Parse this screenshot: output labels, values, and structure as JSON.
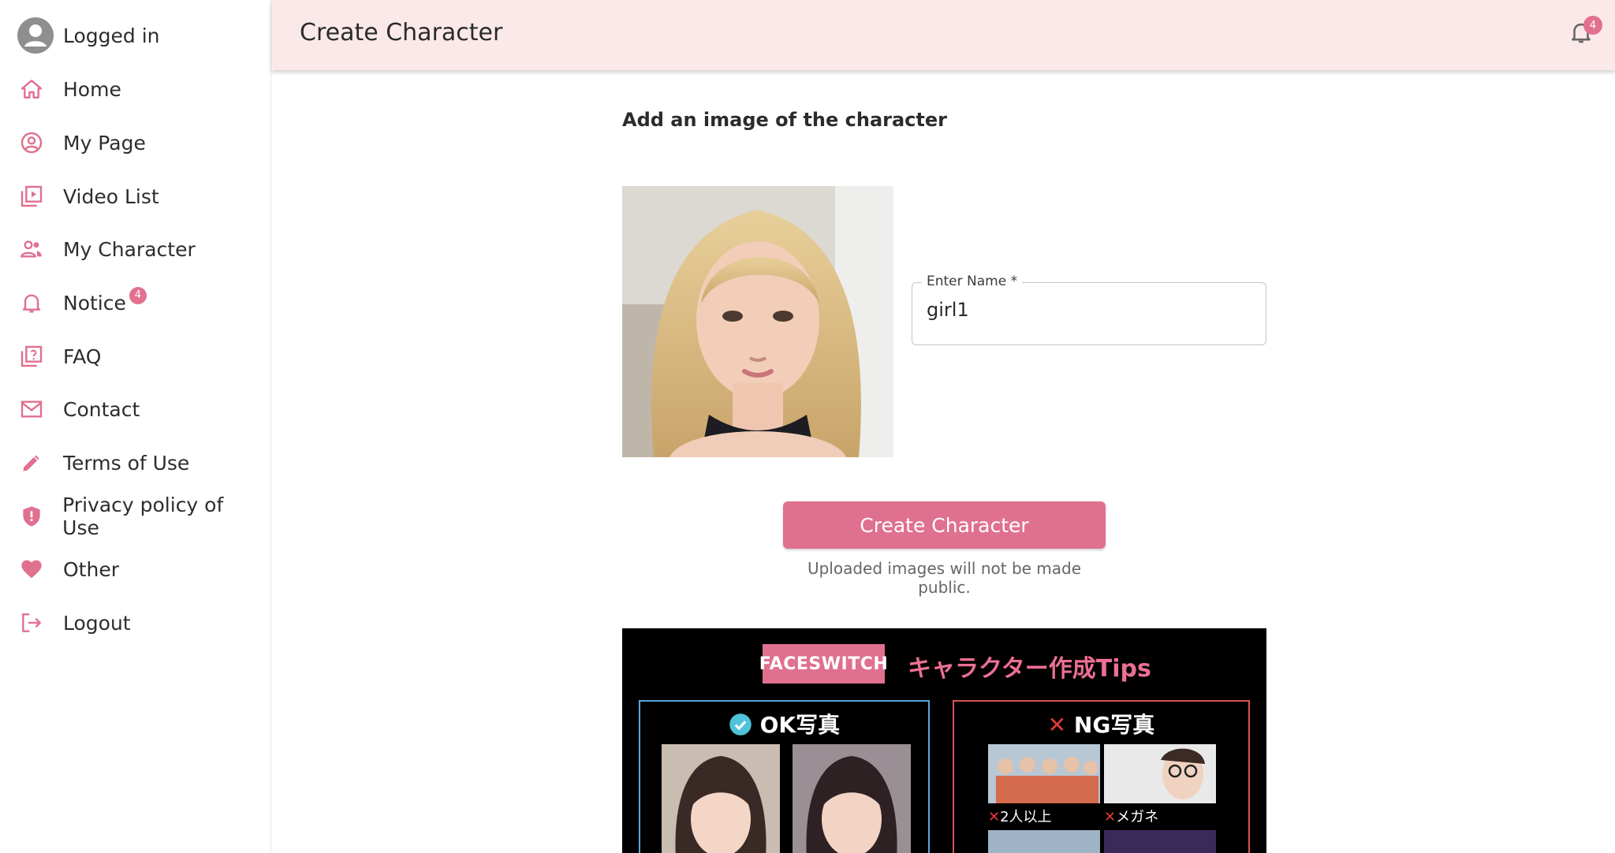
{
  "sidebar": {
    "user_label": "Logged in",
    "items": [
      {
        "label": "Home",
        "icon": "home-icon"
      },
      {
        "label": "My Page",
        "icon": "account-circle-icon"
      },
      {
        "label": "Video List",
        "icon": "video-library-icon"
      },
      {
        "label": "My Character",
        "icon": "people-icon"
      },
      {
        "label": "Notice",
        "icon": "bell-icon",
        "badge": "4"
      },
      {
        "label": "FAQ",
        "icon": "question-box-icon"
      },
      {
        "label": "Contact",
        "icon": "mail-icon"
      },
      {
        "label": "Terms of Use",
        "icon": "pencil-icon"
      },
      {
        "label": "Privacy policy of Use",
        "icon": "shield-icon"
      },
      {
        "label": "Other",
        "icon": "heart-icon"
      },
      {
        "label": "Logout",
        "icon": "logout-icon"
      }
    ]
  },
  "header": {
    "title": "Create Character",
    "notification_count": "4"
  },
  "main": {
    "section_title": "Add an image of the character",
    "name_field": {
      "label": "Enter Name *",
      "value": "girl1"
    },
    "create_button": "Create Character",
    "notice": "Uploaded images will not be made public."
  },
  "tips_banner": {
    "brand": "FACESWITCH",
    "title": "キャラクター作成Tips",
    "ok_heading": "OK写真",
    "ng_heading": "NG写真",
    "ng_captions": [
      "2人以上",
      "メガネ"
    ]
  },
  "colors": {
    "accent": "#e0708f",
    "header_bg": "#fbe9ea"
  }
}
